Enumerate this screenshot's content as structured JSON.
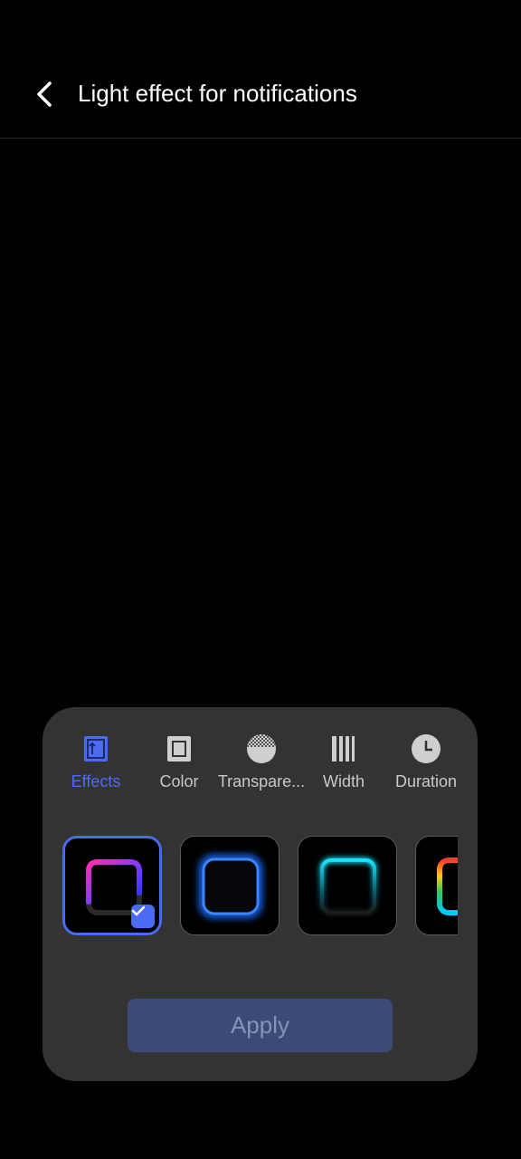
{
  "header": {
    "title": "Light effect for notifications"
  },
  "tabs": [
    {
      "label": "Effects",
      "icon": "effects-icon",
      "active": true
    },
    {
      "label": "Color",
      "icon": "color-icon",
      "active": false
    },
    {
      "label": "Transpare...",
      "icon": "transparency-icon",
      "active": false
    },
    {
      "label": "Width",
      "icon": "width-icon",
      "active": false
    },
    {
      "label": "Duration",
      "icon": "duration-icon",
      "active": false
    }
  ],
  "effects": [
    {
      "name": "gradient-pink-blue",
      "selected": true
    },
    {
      "name": "blue-glow",
      "selected": false
    },
    {
      "name": "cyan-glow",
      "selected": false
    },
    {
      "name": "rainbow",
      "selected": false
    }
  ],
  "apply_button": {
    "label": "Apply",
    "enabled": false
  },
  "colors": {
    "accent": "#4a6bf2",
    "panel": "#333333",
    "background": "#000000"
  }
}
